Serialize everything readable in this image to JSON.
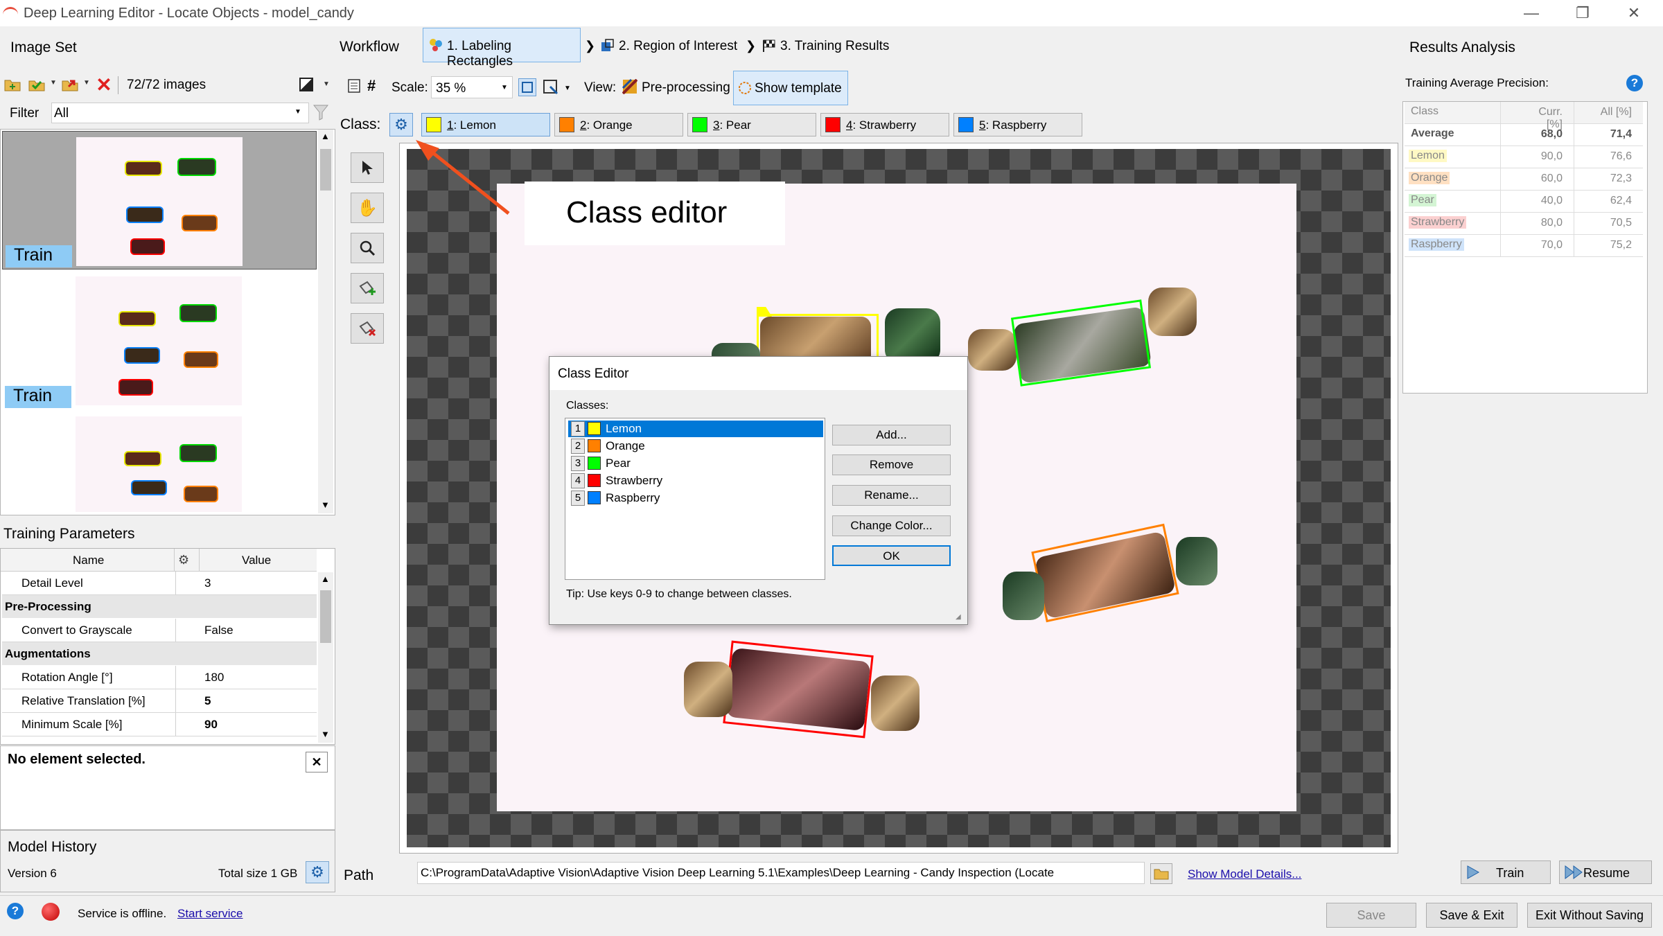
{
  "window": {
    "title": "Deep Learning Editor - Locate Objects - model_candy",
    "controls": [
      "—",
      "❐",
      "✕"
    ]
  },
  "image_set": {
    "header": "Image Set",
    "count": "72/72 images",
    "filter_label": "Filter",
    "filter_value": "All",
    "thumbnails": [
      {
        "label": "Train"
      },
      {
        "label": "Train"
      },
      {
        "label": ""
      }
    ]
  },
  "workflow": {
    "label": "Workflow",
    "steps": [
      {
        "label": "1. Labeling Rectangles"
      },
      {
        "label": "2. Region of Interest"
      },
      {
        "label": "3. Training Results"
      }
    ]
  },
  "toolbar": {
    "scale_label": "Scale:",
    "scale_value": "35 %",
    "view_label": "View:",
    "preprocessing": "Pre-processing",
    "show_template": "Show template"
  },
  "classes": {
    "label": "Class:",
    "items": [
      {
        "num": "1",
        "name": ": Lemon",
        "color": "#ffff00"
      },
      {
        "num": "2",
        "name": ": Orange",
        "color": "#ff8000"
      },
      {
        "num": "3",
        "name": ": Pear",
        "color": "#00ff00"
      },
      {
        "num": "4",
        "name": ": Strawberry",
        "color": "#ff0000"
      },
      {
        "num": "5",
        "name": ": Raspberry",
        "color": "#0080ff"
      }
    ]
  },
  "annotation": {
    "callout": "Class editor"
  },
  "class_editor": {
    "title": "Class Editor",
    "classes_label": "Classes:",
    "list": [
      {
        "num": "1",
        "name": "Lemon",
        "color": "#ffff00"
      },
      {
        "num": "2",
        "name": "Orange",
        "color": "#ff8000"
      },
      {
        "num": "3",
        "name": "Pear",
        "color": "#00ff00"
      },
      {
        "num": "4",
        "name": "Strawberry",
        "color": "#ff0000"
      },
      {
        "num": "5",
        "name": "Raspberry",
        "color": "#0080ff"
      }
    ],
    "buttons": {
      "add": "Add...",
      "remove": "Remove",
      "rename": "Rename...",
      "change_color": "Change Color...",
      "ok": "OK"
    },
    "tip": "Tip: Use keys 0-9 to change between classes."
  },
  "training_params": {
    "header": "Training Parameters",
    "col_name": "Name",
    "col_value": "Value",
    "rows": [
      {
        "type": "row",
        "name": "Detail Level",
        "value": "3"
      },
      {
        "type": "group",
        "name": "Pre-Processing"
      },
      {
        "type": "row",
        "name": "Convert to Grayscale",
        "value": "False"
      },
      {
        "type": "group",
        "name": "Augmentations"
      },
      {
        "type": "row",
        "name": "Rotation Angle [°]",
        "value": "180"
      },
      {
        "type": "row",
        "name": "Relative Translation [%]",
        "value": "5"
      },
      {
        "type": "row",
        "name": "Minimum Scale [%]",
        "value": "90"
      }
    ]
  },
  "selection": {
    "text": "No element selected."
  },
  "model_history": {
    "header": "Model History",
    "version": "Version 6",
    "total_size": "Total size 1 GB"
  },
  "status": {
    "text": "Service is offline.",
    "link": "Start service"
  },
  "path": {
    "label": "Path",
    "value": "C:\\ProgramData\\Adaptive Vision\\Adaptive Vision Deep Learning 5.1\\Examples\\Deep Learning - Candy Inspection (Locate",
    "details_link": "Show Model Details..."
  },
  "results": {
    "header": "Results Analysis",
    "subtitle": "Training Average Precision:",
    "help_icon": "?",
    "columns": [
      "Class",
      "Curr. [%]",
      "All [%]"
    ],
    "rows": [
      {
        "class": "Average",
        "curr": "68,0",
        "all": "71,4",
        "bg": ""
      },
      {
        "class": "Lemon",
        "curr": "90,0",
        "all": "76,6",
        "bg": "#fff9c4"
      },
      {
        "class": "Orange",
        "curr": "60,0",
        "all": "72,3",
        "bg": "#ffe0c2"
      },
      {
        "class": "Pear",
        "curr": "40,0",
        "all": "62,4",
        "bg": "#d4f5d4"
      },
      {
        "class": "Strawberry",
        "curr": "80,0",
        "all": "70,5",
        "bg": "#fbd0d0"
      },
      {
        "class": "Raspberry",
        "curr": "70,0",
        "all": "75,2",
        "bg": "#cfe3fa"
      }
    ]
  },
  "actions": {
    "train": "Train",
    "resume": "Resume",
    "save": "Save",
    "save_exit": "Save & Exit",
    "exit_nosave": "Exit Without Saving"
  }
}
